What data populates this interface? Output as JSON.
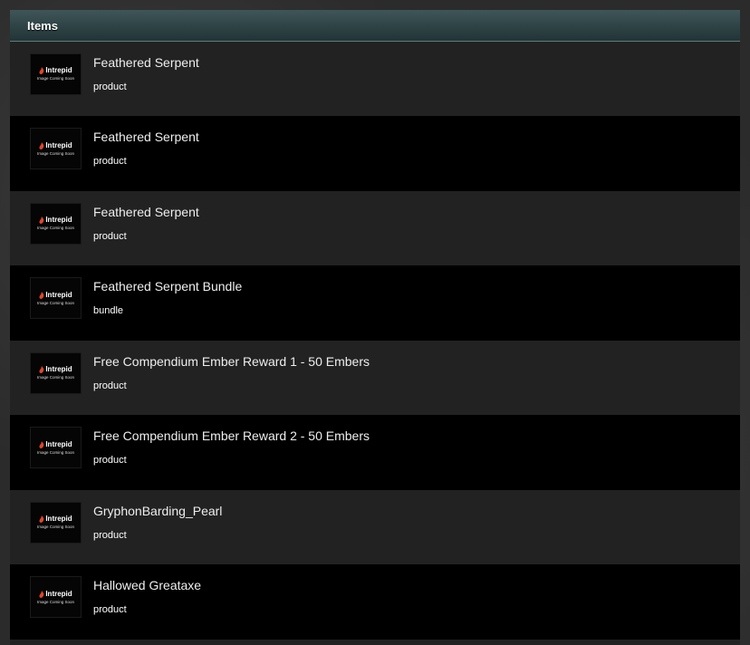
{
  "panel": {
    "title": "Items"
  },
  "thumbnail": {
    "logo_text": "Intrepid",
    "caption": "Image Coming Soon"
  },
  "items": [
    {
      "name": "Feathered Serpent",
      "type": "product"
    },
    {
      "name": "Feathered Serpent",
      "type": "product"
    },
    {
      "name": "Feathered Serpent",
      "type": "product"
    },
    {
      "name": "Feathered Serpent Bundle",
      "type": "bundle"
    },
    {
      "name": "Free Compendium Ember Reward 1 - 50 Embers",
      "type": "product"
    },
    {
      "name": "Free Compendium Ember Reward 2 - 50 Embers",
      "type": "product"
    },
    {
      "name": "GryphonBarding_Pearl",
      "type": "product"
    },
    {
      "name": "Hallowed Greataxe",
      "type": "product"
    }
  ],
  "colors": {
    "header_accent": "#2f4446",
    "row_dark": "#000000",
    "row_light": "#222222",
    "logo_accent": "#e0462a"
  }
}
